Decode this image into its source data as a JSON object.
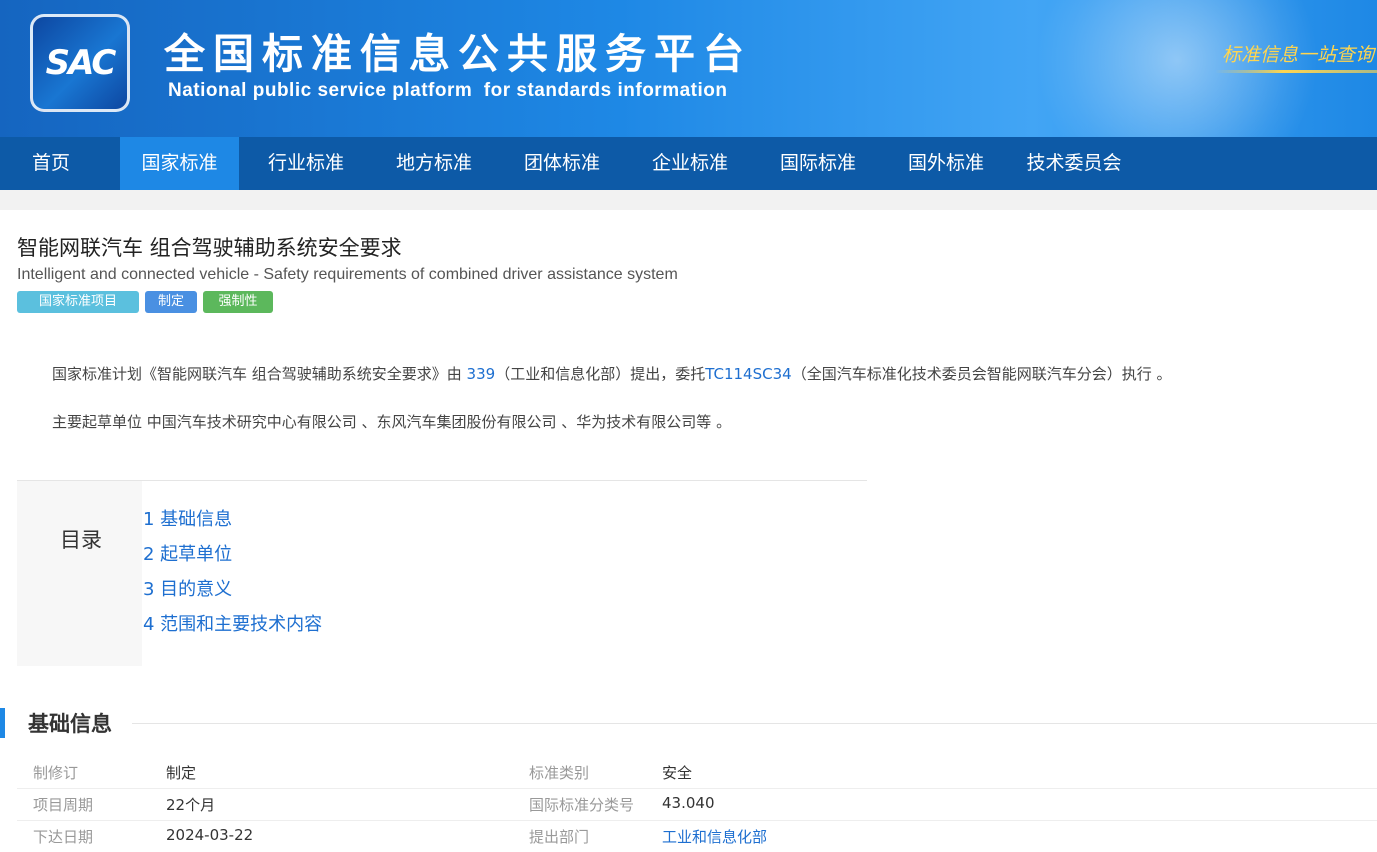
{
  "header": {
    "logo_text": "SAC",
    "title_cn": "全国标准信息公共服务平台",
    "title_en": "National public service platform  for standards information",
    "slogan": "标准信息一站查询"
  },
  "nav": {
    "items": [
      {
        "label": "首页"
      },
      {
        "label": "国家标准"
      },
      {
        "label": "行业标准"
      },
      {
        "label": "地方标准"
      },
      {
        "label": "团体标准"
      },
      {
        "label": "企业标准"
      },
      {
        "label": "国际标准"
      },
      {
        "label": "国外标准"
      },
      {
        "label": "技术委员会"
      }
    ],
    "active": "国家标准"
  },
  "standard": {
    "title_cn": "智能网联汽车 组合驾驶辅助系统安全要求",
    "title_en": "Intelligent and connected vehicle - Safety requirements of combined driver assistance system",
    "tags": [
      {
        "label": "国家标准项目",
        "color": "#5bc0de"
      },
      {
        "label": "制定",
        "color": "#4a90e2"
      },
      {
        "label": "强制性",
        "color": "#5cb85c"
      }
    ]
  },
  "description": {
    "line1_a": "国家标准计划《智能网联汽车 组合驾驶辅助系统安全要求》由 ",
    "line1_link1": "339",
    "line1_b": "（工业和信息化部）提出，委托",
    "line1_link2": "TC114SC34",
    "line1_c": "（全国汽车标准化技术委员会智能网联汽车分会）执行 。",
    "line2": "主要起草单位 中国汽车技术研究中心有限公司 、东风汽车集团股份有限公司 、华为技术有限公司等 。"
  },
  "toc": {
    "label": "目录",
    "items": [
      {
        "label": "1  基础信息"
      },
      {
        "label": "2  起草单位"
      },
      {
        "label": "3  目的意义"
      },
      {
        "label": "4  范围和主要技术内容"
      }
    ]
  },
  "basic_info": {
    "title": "基础信息",
    "rows": [
      {
        "label1": "制修订",
        "value1": "制定",
        "label2": "标准类别",
        "value2": "安全"
      },
      {
        "label1": "项目周期",
        "value1": "22个月",
        "label2": "国际标准分类号",
        "value2": "43.040"
      },
      {
        "label1": "下达日期",
        "value1": "2024-03-22",
        "label2": "提出部门",
        "value2": "工业和信息化部"
      }
    ]
  }
}
